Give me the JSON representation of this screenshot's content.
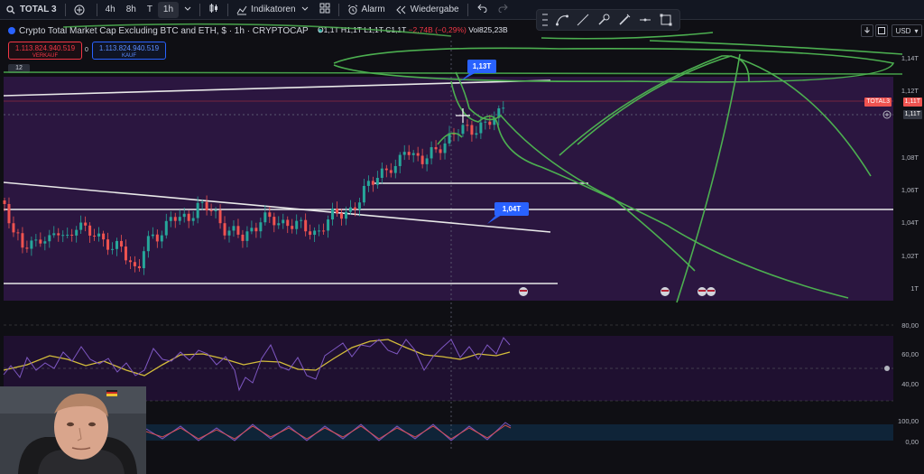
{
  "toolbar": {
    "symbol": "TOTAL 3",
    "intervals": [
      "4h",
      "8h",
      "T",
      "1h"
    ],
    "active_interval": "1h",
    "indicators_label": "Indikatoren",
    "alarm_label": "Alarm",
    "replay_label": "Wiedergabe"
  },
  "symbol_info": {
    "title": "Crypto Total Market Cap Excluding BTC and ETH, $ · 1h · CRYPTOCAP",
    "ohlc_o": "O1,1T",
    "ohlc_h": "H1,1T",
    "ohlc_l": "L1,1T",
    "ohlc_c": "C1,1T",
    "change": "−2,74B (−0,29%)",
    "volume": "Vol825,23B"
  },
  "trade": {
    "sell_price": "1.113.824.940.519",
    "sell_label": "VERKAUF",
    "spread": "0",
    "buy_price": "1.113.824.940.519",
    "buy_label": "KAUF",
    "zoom": "12"
  },
  "top_right": {
    "currency": "USD"
  },
  "price_scale": [
    "1,14T",
    "1,12T",
    "1,08T",
    "1,06T",
    "1,04T",
    "1,02T",
    "1T"
  ],
  "price_badges": {
    "symbol": "TOTAL3",
    "last": "1,11T",
    "crosshair": "1,11T"
  },
  "callouts": {
    "high": "1,13T",
    "low": "1,04T"
  },
  "rsi_scale": [
    "80,00",
    "60,00",
    "40,00"
  ],
  "stoch_scale": [
    "100,00",
    "0,00"
  ],
  "colors": {
    "background": "#0f0f14",
    "chart_band": "#2b1640",
    "up_candle": "#26a69a",
    "down_candle": "#ef5350",
    "drawing_green": "#4caf50",
    "accent_blue": "#2962ff"
  }
}
